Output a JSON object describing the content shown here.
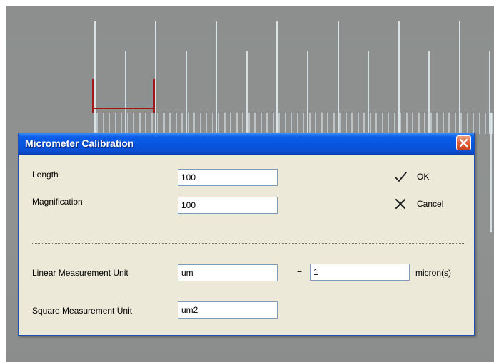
{
  "dialog": {
    "title": "Micrometer Calibration",
    "length_label": "Length",
    "length_value": "100",
    "magnification_label": "Magnification",
    "magnification_value": "100",
    "ok_label": "OK",
    "cancel_label": "Cancel",
    "linear_unit_label": "Linear Measurement Unit",
    "linear_unit_value": "um",
    "equals": "=",
    "factor_value": "1",
    "micron_label": "micron(s)",
    "square_unit_label": "Square Measurement Unit",
    "square_unit_value": "um2"
  },
  "icons": {
    "ok": "checkmark-icon",
    "cancel": "cross-icon",
    "close": "close-icon"
  },
  "colors": {
    "title_bar": "#0755e0",
    "dialog_bg": "#ece9d8",
    "close_button": "#e0603a",
    "measure_marker": "#a01818",
    "ruler_ticks": "#e6f2f8"
  }
}
